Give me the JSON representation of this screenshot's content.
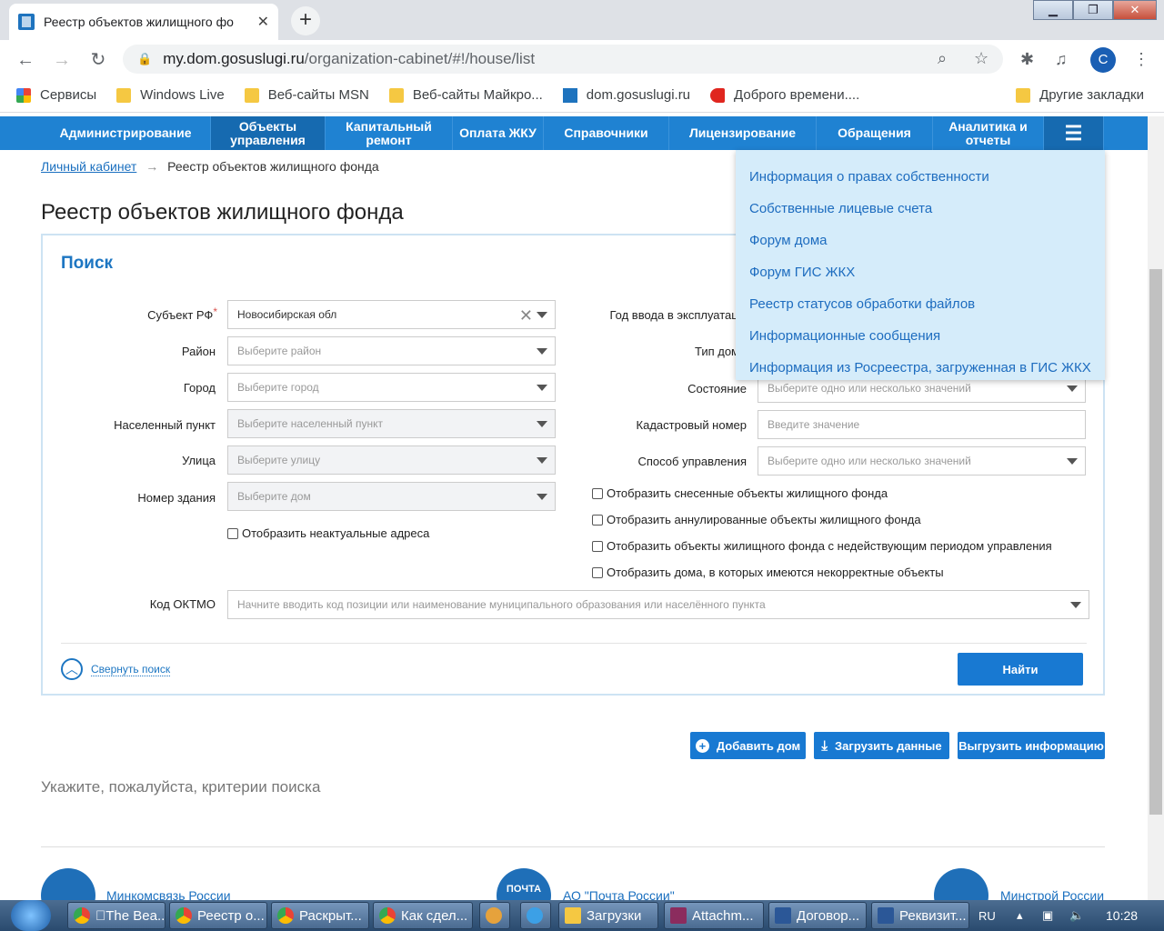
{
  "browser": {
    "tab_title": "Реестр объектов жилищного фо",
    "url_host": "my.dom.gosuslugi.ru",
    "url_path": "/organization-cabinet/#!/house/list",
    "avatar_letter": "С",
    "bookmarks": [
      "Сервисы",
      "Windows Live",
      "Веб-сайты MSN",
      "Веб-сайты Майкро...",
      "dom.gosuslugi.ru",
      "Доброго времени...."
    ],
    "other_bookmarks": "Другие закладки"
  },
  "nav": {
    "items": [
      {
        "label": "Администрирование"
      },
      {
        "label": "Объекты управления"
      },
      {
        "label": "Капитальный ремонт"
      },
      {
        "label": "Оплата ЖКУ"
      },
      {
        "label": "Справочники"
      },
      {
        "label": "Лицензирование"
      },
      {
        "label": "Обращения"
      },
      {
        "label": "Аналитика и отчеты"
      }
    ],
    "menu_icon": "hamburger-icon"
  },
  "breadcrumb": {
    "home": "Личный кабинет",
    "sep": "→",
    "current": "Реестр объектов жилищного фонда"
  },
  "page_title": "Реестр объектов жилищного фонда",
  "search": {
    "title": "Поиск",
    "left_fields": [
      {
        "label": "Субъект РФ",
        "value": "Новосибирская обл",
        "required": "*"
      },
      {
        "label": "Район",
        "placeholder": "Выберите район"
      },
      {
        "label": "Город",
        "placeholder": "Выберите город"
      },
      {
        "label": "Населенный пункт",
        "placeholder": "Выберите населенный пункт"
      },
      {
        "label": "Улица",
        "placeholder": "Выберите улицу"
      },
      {
        "label": "Номер здания",
        "placeholder": "Выберите дом"
      }
    ],
    "right_fields": [
      {
        "label": "Год ввода в эксплуатаци"
      },
      {
        "label": "Тип дом"
      },
      {
        "label": "Состояние",
        "placeholder": "Выберите одно или несколько значений"
      },
      {
        "label": "Кадастровый номер",
        "placeholder": "Введите значение"
      },
      {
        "label": "Способ управления",
        "placeholder": "Выберите одно или несколько значений"
      }
    ],
    "left_checkbox": "Отобразить неактуальные адреса",
    "right_checkboxes": [
      "Отобразить снесенные объекты жилищного фонда",
      "Отобразить аннулированные объекты жилищного фонда",
      "Отобразить объекты жилищного фонда с недействующим периодом управления",
      "Отобразить дома, в которых имеются некорректные объекты"
    ],
    "oktmo": {
      "label": "Код ОКТМО",
      "placeholder": "Начните вводить код позиции или наименование муниципального образования или населённого пункта"
    },
    "collapse_label": "Свернуть поиск",
    "find_button": "Найти"
  },
  "actions": {
    "add_house": "Добавить дом",
    "upload_data": "Загрузить данные",
    "export_info": "Выгрузить информацию"
  },
  "hint": "Укажите, пожалуйста, критерии поиска",
  "footer": {
    "links": [
      "Минкомсвязь России",
      "АО \"Почта России\"",
      "Минстрой России"
    ],
    "emblem_text": "ПОЧТА"
  },
  "dropdown": {
    "items": [
      "Информация о правах собственности",
      "Собственные лицевые счета",
      "Форум дома",
      "Форум ГИС ЖКХ",
      "Реестр статусов обработки файлов",
      "Информационные сообщения",
      "Информация из Росреестра, загруженная в ГИС ЖКХ"
    ]
  },
  "taskbar": {
    "tasks": [
      "\u0000The Bea...",
      "Реестр о...",
      "Раскрыт...",
      "Как сдел...",
      "Загрузки",
      "Attachm...",
      "Договор...",
      "Реквизит..."
    ],
    "lang": "RU",
    "time": "10:28"
  }
}
